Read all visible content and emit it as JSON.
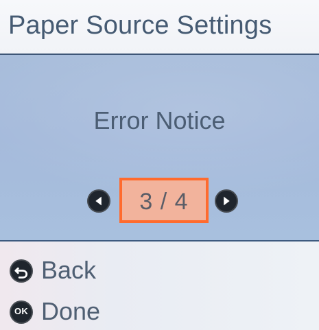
{
  "window": {
    "title": "Paper Source Settings"
  },
  "main": {
    "heading": "Error Notice",
    "pager": {
      "current": 3,
      "total": 4,
      "text": "3 / 4"
    }
  },
  "footer": {
    "back": {
      "label": "Back",
      "icon": "back-icon"
    },
    "done": {
      "label": "Done",
      "icon": "ok-icon",
      "icon_text": "OK"
    }
  },
  "colors": {
    "header_background": "#f3f5f8",
    "main_background": "#a8bddb",
    "highlight_border": "#ff6b2e",
    "highlight_fill": "#f2b39c",
    "text": "#4f5f73",
    "icon_background": "#1f252d"
  }
}
